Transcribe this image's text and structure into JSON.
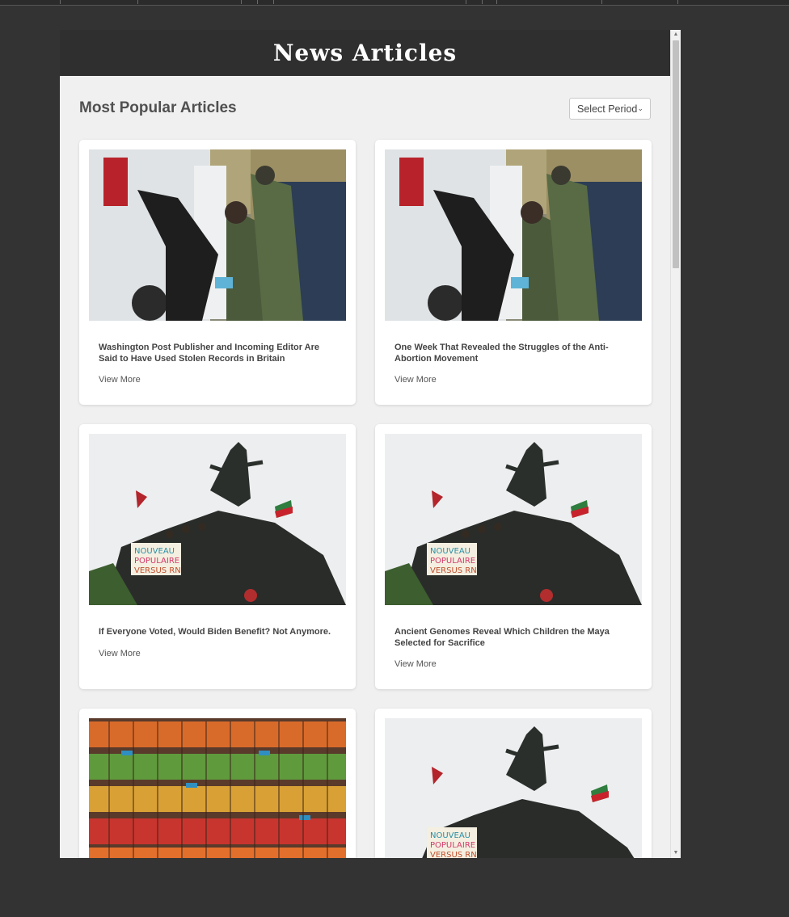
{
  "header": {
    "title": "News Articles"
  },
  "page": {
    "title": "Most Popular Articles"
  },
  "period_select": {
    "selected": "Select Period"
  },
  "articles": [
    {
      "title": "Washington Post Publisher and Incoming Editor Are Said to Have Used Stolen Records in Britain",
      "link": "View More",
      "image": "border-patrol-arrest-photo"
    },
    {
      "title": "One Week That Revealed the Struggles of the Anti-Abortion Movement",
      "link": "View More",
      "image": "border-patrol-arrest-photo"
    },
    {
      "title": "If Everyone Voted, Would Biden Benefit? Not Anymore.",
      "link": "View More",
      "image": "statue-protest-photo"
    },
    {
      "title": "Ancient Genomes Reveal Which Children the Maya Selected for Sacrifice",
      "link": "View More",
      "image": "statue-protest-photo"
    },
    {
      "title": "",
      "link": "",
      "image": "grocery-shelves-photo"
    },
    {
      "title": "",
      "link": "",
      "image": "statue-protest-photo"
    }
  ],
  "colors": {
    "header_bg": "#2f2f2f",
    "page_bg": "#f0f0f0",
    "card_bg": "#ffffff",
    "outer_bg": "#333333"
  }
}
